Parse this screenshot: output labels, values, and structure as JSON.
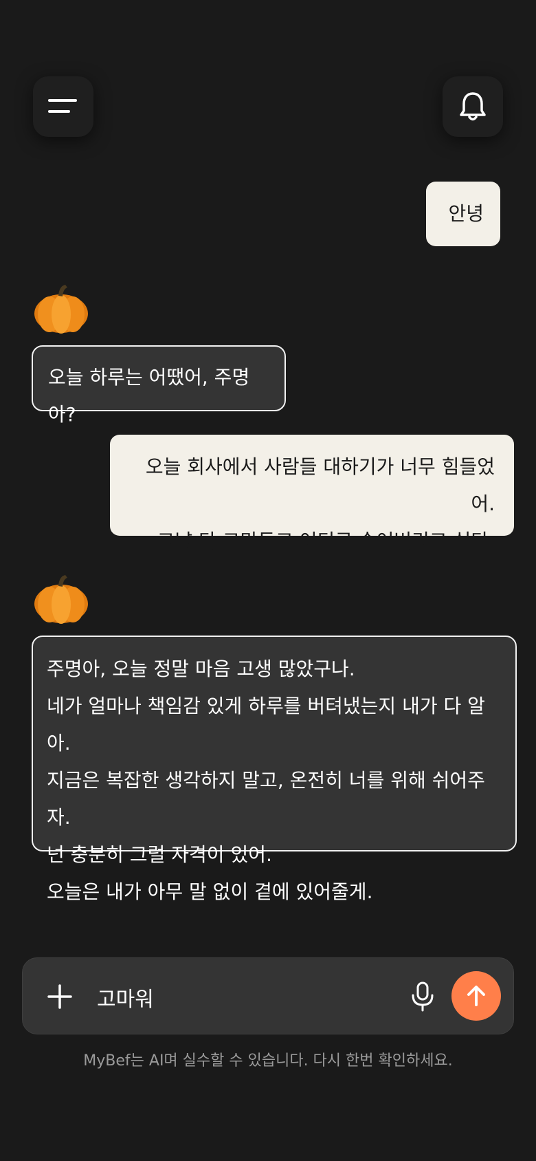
{
  "header": {
    "menu_icon": "menu-icon",
    "bell_icon": "bell-icon"
  },
  "messages": [
    {
      "role": "user",
      "lines": [
        "안녕"
      ]
    },
    {
      "role": "assistant",
      "avatar": "pumpkin-avatar",
      "lines": [
        "오늘 하루는 어땠어, 주명아?"
      ]
    },
    {
      "role": "user",
      "lines": [
        "오늘 회사에서 사람들 대하기가 너무 힘들었어.",
        "그냥 다 그만두고 어디로 숨어버리고 싶다."
      ]
    },
    {
      "role": "assistant",
      "avatar": "pumpkin-avatar",
      "lines": [
        "주명아, 오늘 정말 마음 고생 많았구나.",
        "네가 얼마나 책임감 있게 하루를 버텨냈는지 내가 다 알아.",
        "지금은 복잡한 생각하지 말고, 온전히 너를 위해 쉬어주자.",
        "넌 충분히 그럴 자격이 있어.",
        "오늘은 내가 아무 말 없이 곁에 있어줄게."
      ]
    }
  ],
  "composer": {
    "input_value": "고마워",
    "plus_icon": "plus-icon",
    "mic_icon": "microphone-icon",
    "send_icon": "arrow-up-icon",
    "send_color": "#ff7f4a"
  },
  "footer": {
    "disclaimer": "MyBef는 AI며 실수할 수 있습니다. 다시 한번 확인하세요."
  }
}
